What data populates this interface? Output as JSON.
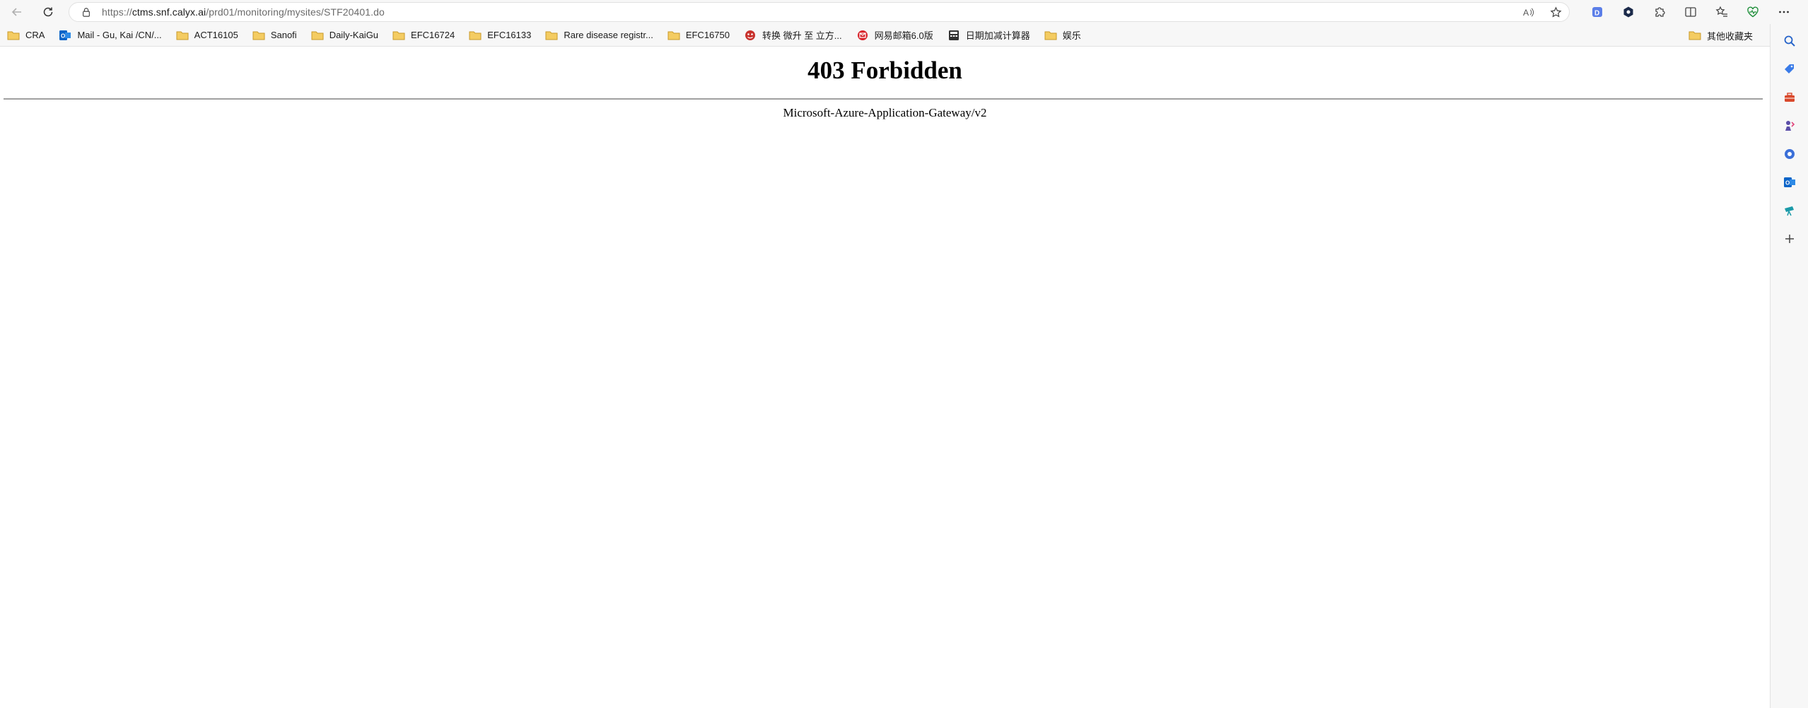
{
  "browser": {
    "url_scheme": "https://",
    "url_host": "ctms.snf.calyx.ai",
    "url_path": "/prd01/monitoring/mysites/STF20401.do"
  },
  "bookmarks": [
    {
      "label": "CRA",
      "icon": "folder-icon"
    },
    {
      "label": "Mail - Gu, Kai /CN/...",
      "icon": "outlook-icon"
    },
    {
      "label": "ACT16105",
      "icon": "folder-icon"
    },
    {
      "label": "Sanofi",
      "icon": "folder-icon"
    },
    {
      "label": "Daily-KaiGu",
      "icon": "folder-icon"
    },
    {
      "label": "EFC16724",
      "icon": "folder-icon"
    },
    {
      "label": "EFC16133",
      "icon": "folder-icon"
    },
    {
      "label": "Rare disease registr...",
      "icon": "folder-icon"
    },
    {
      "label": "EFC16750",
      "icon": "folder-icon"
    },
    {
      "label": "转换 微升 至 立方...",
      "icon": "converter-icon"
    },
    {
      "label": "网易邮箱6.0版",
      "icon": "netease-mail-icon"
    },
    {
      "label": "日期加减计算器",
      "icon": "calculator-icon"
    },
    {
      "label": "娱乐",
      "icon": "folder-icon"
    }
  ],
  "other_favorites_label": "其他收藏夹",
  "colors": {
    "toolbar_bg": "#f7f7f7",
    "folder": "#e8b83c",
    "outlook_blue": "#0a64c8",
    "accent_blue": "#3b6fd8"
  },
  "page": {
    "heading": "403 Forbidden",
    "server": "Microsoft-Azure-Application-Gateway/v2"
  }
}
